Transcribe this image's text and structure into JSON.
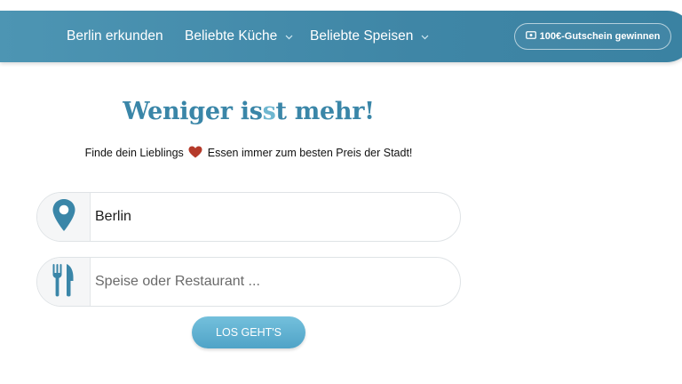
{
  "nav": {
    "items": [
      {
        "label": "Berlin erkunden"
      },
      {
        "label": "Beliebte Küche"
      },
      {
        "label": "Beliebte Speisen"
      }
    ],
    "voucher_label": "100€-Gutschein gewinnen"
  },
  "hero": {
    "headline_part1": "Weniger is",
    "headline_accent": "s",
    "headline_part2": "t mehr!",
    "tagline_before": "Finde dein Lieblings",
    "tagline_after": "Essen immer zum besten Preis der Stadt!"
  },
  "search": {
    "location_value": "Berlin",
    "food_placeholder": "Speise oder Restaurant ...",
    "submit_label": "LOS GEHT'S"
  },
  "colors": {
    "brand": "#3f86a6",
    "accent": "#6fb7d0",
    "heart": "#b53a2a"
  },
  "icons": [
    "chevron-down-icon",
    "ticket-icon",
    "heart-icon",
    "location-pin-icon",
    "cutlery-icon"
  ]
}
